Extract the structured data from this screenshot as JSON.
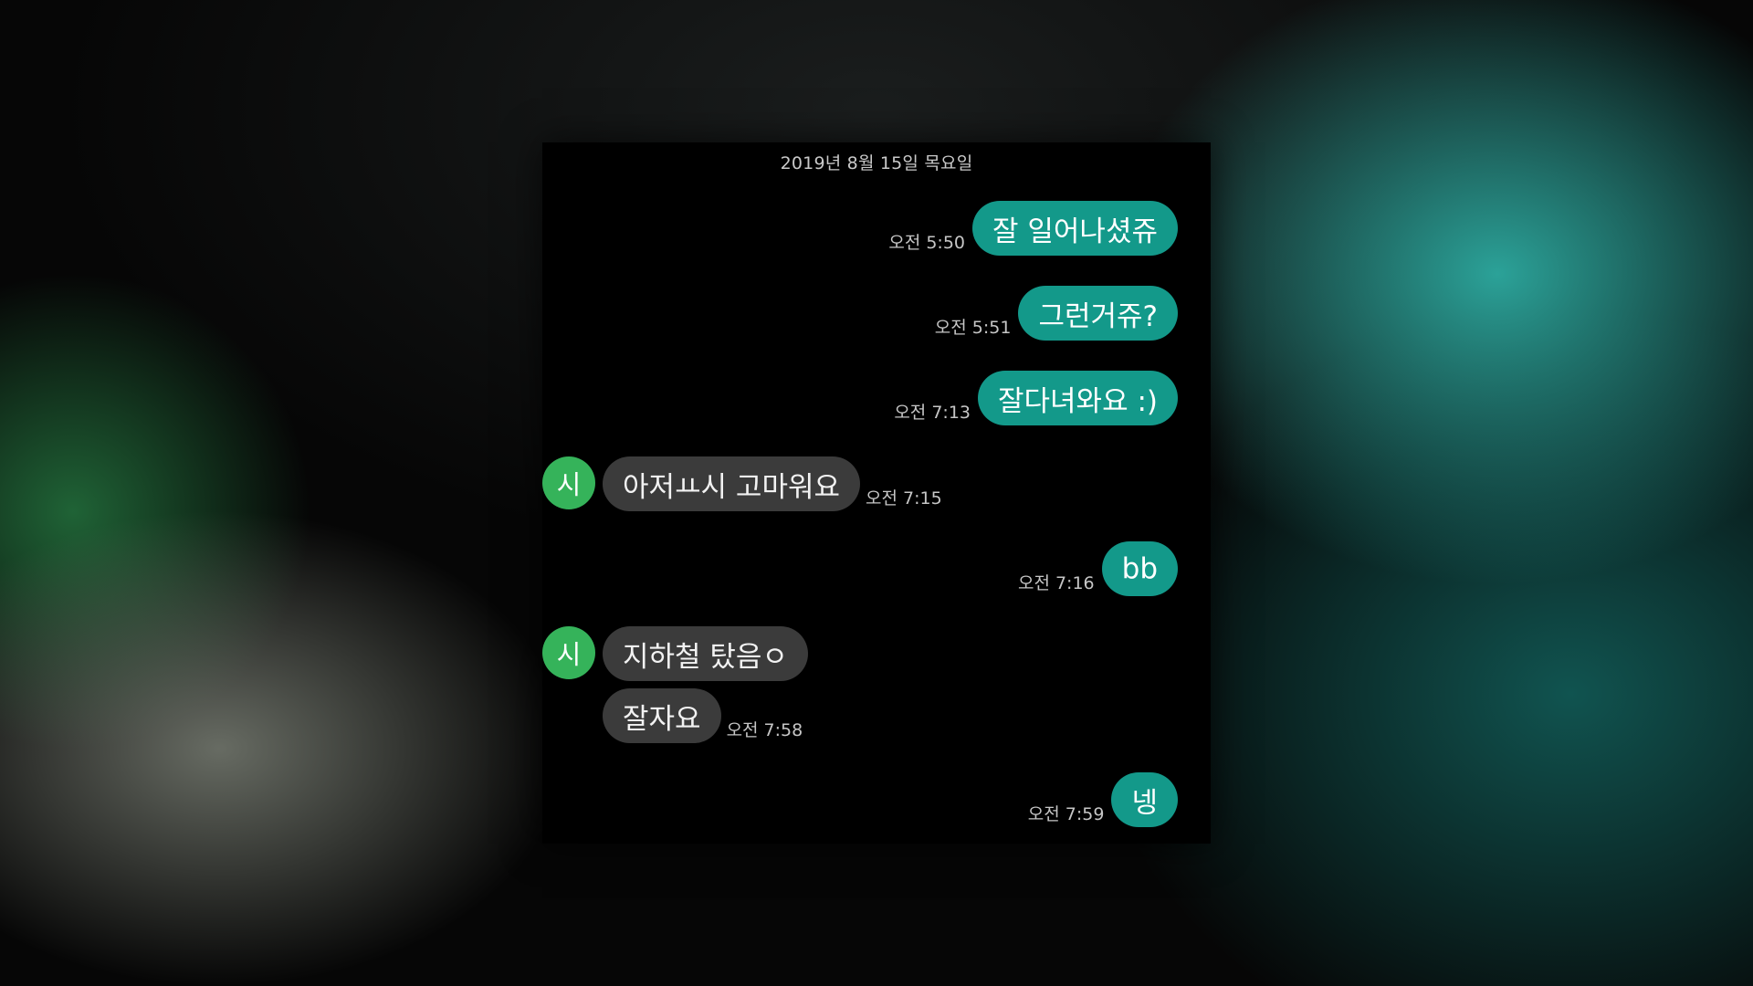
{
  "chat": {
    "date_header": "2019년 8월 15일 목요일",
    "avatar_initial": "시",
    "messages": [
      {
        "text": "잘 일어나셨쥬",
        "time": "오전 5:50"
      },
      {
        "text": "그런거쥬?",
        "time": "오전 5:51"
      },
      {
        "text": "잘다녀와요 :)",
        "time": "오전 7:13"
      },
      {
        "text": "아저ㅛ시 고마워요",
        "time": "오전 7:15"
      },
      {
        "text": "bb",
        "time": "오전 7:16"
      },
      {
        "text": "지하철 탔음ㅇ",
        "time": ""
      },
      {
        "text": "잘자요",
        "time": "오전 7:58"
      },
      {
        "text": "넹",
        "time": "오전 7:59"
      }
    ]
  },
  "colors": {
    "my_bubble": "#13998a",
    "their_bubble": "#3b3b3b",
    "avatar": "#35b35a",
    "window_background": "#000000"
  }
}
